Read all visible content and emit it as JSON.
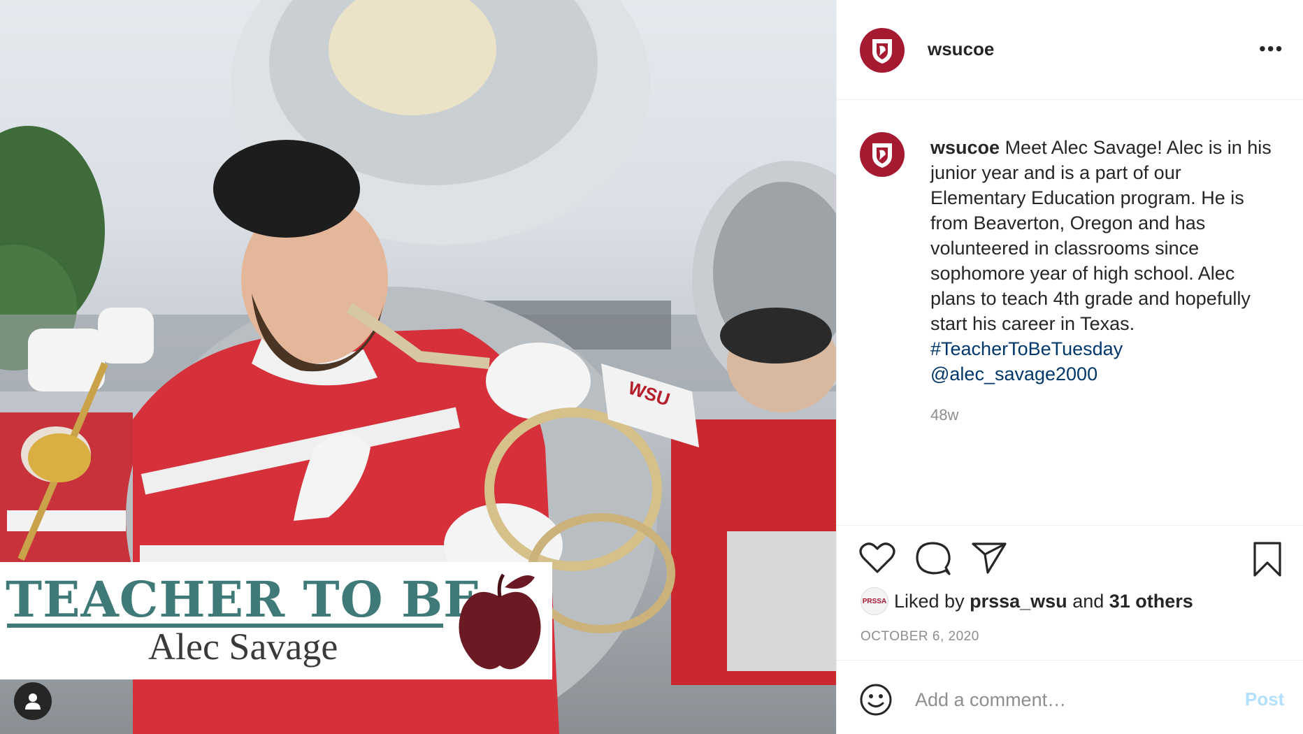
{
  "post": {
    "username": "wsucoe",
    "more_label": "•••",
    "image": {
      "banner_title": "TEACHER TO BE",
      "banner_name": "Alec Savage",
      "sleeve_text": "WSU",
      "user_tag_icon": "person-icon"
    },
    "caption": {
      "username": "wsucoe",
      "text": "Meet Alec Savage! Alec is in his junior year and is a part of our Elementary Education program. He is from Beaverton, Oregon and has volunteered in classrooms since sophomore year of high school. Alec plans to teach 4th grade and hopefully start his career in Texas.",
      "hashtag": "#TeacherToBeTuesday",
      "mention": "@alec_savage2000",
      "time_ago": "48w"
    },
    "actions": {
      "like_icon": "heart-icon",
      "comment_icon": "comment-icon",
      "share_icon": "send-icon",
      "save_icon": "bookmark-icon"
    },
    "likes": {
      "prefix": "Liked by",
      "user": "prssa_wsu",
      "and": "and",
      "others": "31 others",
      "avatar_text": "PRSSA"
    },
    "date": "OCTOBER 6, 2020",
    "comment": {
      "placeholder": "Add a comment…",
      "post_label": "Post",
      "emoji_icon": "smiley-icon"
    }
  },
  "colors": {
    "brand_crimson": "#a51931",
    "link": "#00376b",
    "muted": "#8e8e8e",
    "post_disabled": "#b2dffc",
    "banner_teal": "#3f7a78",
    "apple": "#6b1a24"
  }
}
